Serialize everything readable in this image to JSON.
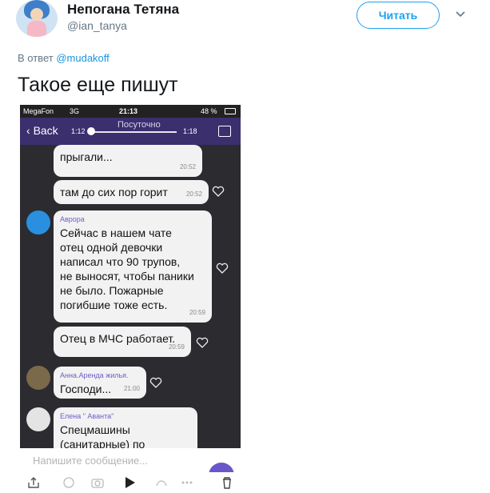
{
  "tweet": {
    "display_name": "Непогана Тетяна",
    "handle": "@ian_tanya",
    "follow_label": "Читать",
    "reply_prefix": "В ответ",
    "reply_mention": "@mudakoff",
    "text": "Такое еще пишут"
  },
  "phone": {
    "status": {
      "carrier": "MegaFon",
      "network": "3G",
      "time": "21:13",
      "battery": "48 %"
    },
    "nav": {
      "back_label": "Back",
      "title": "Посуточно",
      "time_current": "1:12",
      "time_total": "1:18"
    },
    "messages": [
      {
        "sender": "",
        "text": "прыгали...",
        "time": "20:52"
      },
      {
        "sender": "",
        "text": "там до сих пор горит",
        "time": "20:52"
      },
      {
        "sender": "Аврора",
        "lines": [
          "Сейчас в нашем чате",
          "отец одной девочки",
          "написал что 90 трупов,",
          "не выносят, чтобы паники",
          "не было. Пожарные",
          "погибшие тоже есть."
        ],
        "time": "20:59"
      },
      {
        "sender": "",
        "text": "Отец в МЧС работает.",
        "time": "20:59"
      },
      {
        "sender": "Анна.Аренда жилья.",
        "text": "Господи...",
        "time": "21:00"
      },
      {
        "sender": "Елена \" Аванта\"",
        "lines": [
          "Спецмашины",
          "(санитарные) по"
        ],
        "time": ""
      }
    ],
    "input_placeholder": "Напишите сообщение..."
  },
  "colors": {
    "accent": "#1da1f2",
    "viber_purple": "#3b2f6e",
    "chat_bg": "#2b2b30"
  }
}
